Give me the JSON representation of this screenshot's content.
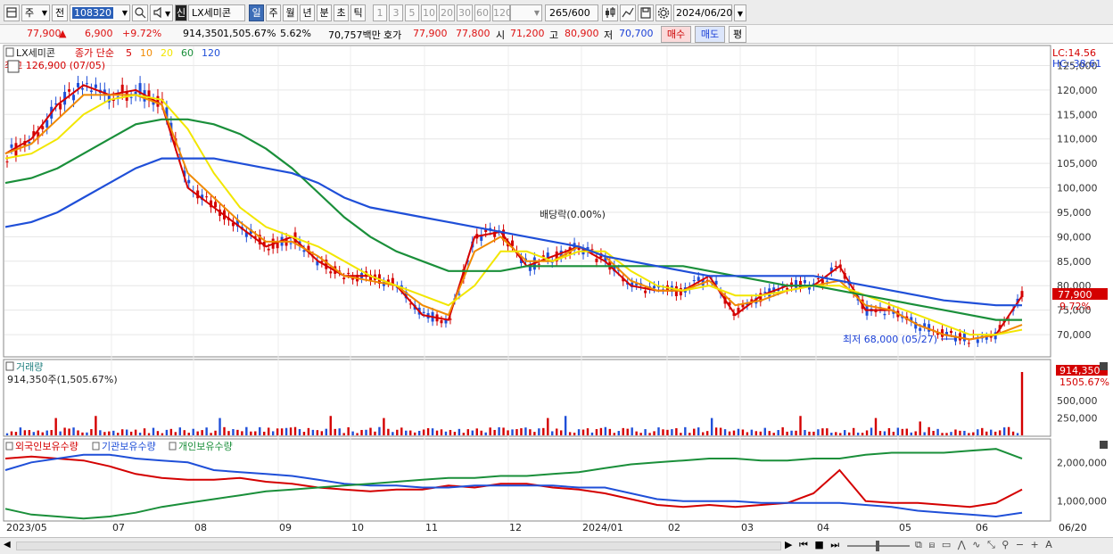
{
  "toolbar": {
    "market": "주",
    "prev_label": "전",
    "code": "108320",
    "name_prefix": "신",
    "name": "LX세미콘",
    "periods": [
      "일",
      "주",
      "월",
      "년",
      "분",
      "초",
      "틱"
    ],
    "active_period": "일",
    "intervals": [
      "1",
      "3",
      "5",
      "10",
      "20",
      "30",
      "60",
      "120"
    ],
    "count": "265",
    "count_max": "/600",
    "date": "2024/06/20"
  },
  "quote": {
    "price": "77,900",
    "change_arrow": "▲",
    "change": "6,900",
    "change_pct": "+9.72%",
    "volume": "914,350",
    "volume_pct": "1,505.67%",
    "turnover_pct": "5.62%",
    "amount": "70,757백만",
    "ask_label": "호가",
    "ask": "77,900",
    "bid": "77,800",
    "open_label": "시",
    "open": "71,200",
    "high_label": "고",
    "high": "80,900",
    "low_label": "저",
    "low": "70,700",
    "buy": "매수",
    "sell": "매도",
    "eval": "평"
  },
  "price_panel": {
    "name": "LX세미콘",
    "ma_label": "종가 단순",
    "ma_periods": [
      "5",
      "10",
      "20",
      "60",
      "120"
    ],
    "ma_colors": [
      "#d40000",
      "#f08a00",
      "#f2e600",
      "#1a8f3a",
      "#1f4fd8"
    ],
    "max_label": "최고 126,900 (07/05)",
    "min_label": "최저 68,000 (05/27)",
    "dividend_label": "배당락(0.00%)",
    "lc": "LC:14.56",
    "hc": "HC:-38.61",
    "last_price": "77,900",
    "last_pct": "9.72%",
    "y_ticks": [
      "125,000",
      "120,000",
      "115,000",
      "110,000",
      "105,000",
      "100,000",
      "95,000",
      "90,000",
      "85,000",
      "80,000",
      "75,000",
      "70,000"
    ]
  },
  "volume_panel": {
    "title": "거래량",
    "value": "914,350주(1,505.67%)",
    "last": "914,350",
    "last_pct": "1505.67%",
    "y_ticks": [
      "500,000",
      "250,000"
    ]
  },
  "holdings_panel": {
    "series": [
      "외국인보유수량",
      "기관보유수량",
      "개인보유수량"
    ],
    "colors": [
      "#d40000",
      "#1f4fd8",
      "#1a8f3a"
    ],
    "y_ticks": [
      "2,000,000",
      "1,000,000"
    ]
  },
  "x_axis": [
    "2023/05",
    "07",
    "08",
    "09",
    "10",
    "11",
    "12",
    "2024/01",
    "02",
    "03",
    "04",
    "05",
    "06",
    "06/20"
  ],
  "chart_data": {
    "type": "candlestick",
    "price_series": [
      {
        "name": "5",
        "values": [
          107000,
          110000,
          117000,
          121000,
          119000,
          120000,
          117000,
          100000,
          96000,
          92000,
          88000,
          90000,
          85000,
          82000,
          82000,
          80000,
          74000,
          73000,
          90000,
          91000,
          84000,
          86000,
          88000,
          85000,
          80000,
          79000,
          79000,
          82000,
          74000,
          78000,
          80000,
          80000,
          84000,
          75000,
          75000,
          72000,
          70000,
          69000,
          70000,
          77900
        ]
      },
      {
        "name": "10",
        "values": [
          107000,
          109000,
          114000,
          119000,
          119000,
          119000,
          117000,
          103000,
          98000,
          93000,
          89000,
          89000,
          86000,
          82000,
          81000,
          80000,
          76000,
          74000,
          87000,
          90000,
          85000,
          85000,
          88000,
          86000,
          81000,
          79000,
          79000,
          81000,
          76000,
          77000,
          79000,
          80000,
          81000,
          76000,
          75000,
          72000,
          70000,
          69000,
          70000,
          72000
        ]
      },
      {
        "name": "20",
        "values": [
          106000,
          107000,
          110000,
          115000,
          118000,
          119000,
          118000,
          112000,
          103000,
          96000,
          92000,
          90000,
          88000,
          85000,
          82000,
          80000,
          78000,
          76000,
          80000,
          87000,
          87000,
          85000,
          87000,
          87000,
          83000,
          80000,
          79000,
          80000,
          78000,
          78000,
          79000,
          80000,
          80000,
          78000,
          76000,
          74000,
          72000,
          70000,
          70000,
          71000
        ]
      },
      {
        "name": "60",
        "values": [
          101000,
          102000,
          104000,
          107000,
          110000,
          113000,
          114000,
          114000,
          113000,
          111000,
          108000,
          104000,
          99000,
          94000,
          90000,
          87000,
          85000,
          83000,
          83000,
          83000,
          84000,
          84000,
          84000,
          84000,
          84000,
          84000,
          84000,
          83000,
          82000,
          81000,
          80000,
          80000,
          79000,
          78000,
          77000,
          76000,
          75000,
          74000,
          73000,
          73000
        ]
      },
      {
        "name": "120",
        "values": [
          92000,
          93000,
          95000,
          98000,
          101000,
          104000,
          106000,
          106000,
          106000,
          105000,
          104000,
          103000,
          101000,
          98000,
          96000,
          95000,
          94000,
          93000,
          92000,
          91000,
          90000,
          89000,
          88000,
          86000,
          85000,
          84000,
          83000,
          82000,
          82000,
          82000,
          82000,
          82000,
          81000,
          80000,
          79000,
          78000,
          77000,
          76500,
          76000,
          76000
        ]
      }
    ],
    "holdings": [
      {
        "name": "외국인보유수량",
        "values": [
          2100000,
          2150000,
          2100000,
          2050000,
          1900000,
          1700000,
          1600000,
          1550000,
          1550000,
          1600000,
          1500000,
          1450000,
          1350000,
          1300000,
          1250000,
          1300000,
          1300000,
          1400000,
          1350000,
          1450000,
          1450000,
          1350000,
          1300000,
          1200000,
          1050000,
          900000,
          850000,
          900000,
          850000,
          900000,
          950000,
          1200000,
          1800000,
          1000000,
          950000,
          950000,
          900000,
          850000,
          950000,
          1300000
        ]
      },
      {
        "name": "기관보유수량",
        "values": [
          1800000,
          2000000,
          2100000,
          2200000,
          2200000,
          2100000,
          2050000,
          2000000,
          1800000,
          1750000,
          1700000,
          1650000,
          1550000,
          1450000,
          1400000,
          1400000,
          1350000,
          1350000,
          1400000,
          1400000,
          1400000,
          1400000,
          1350000,
          1350000,
          1200000,
          1050000,
          1000000,
          1000000,
          1000000,
          950000,
          950000,
          950000,
          950000,
          900000,
          850000,
          750000,
          700000,
          650000,
          600000,
          700000
        ]
      },
      {
        "name": "개인보유수량",
        "values": [
          800000,
          650000,
          600000,
          550000,
          600000,
          700000,
          850000,
          950000,
          1050000,
          1150000,
          1250000,
          1300000,
          1350000,
          1400000,
          1450000,
          1500000,
          1550000,
          1600000,
          1600000,
          1650000,
          1650000,
          1700000,
          1750000,
          1850000,
          1950000,
          2000000,
          2050000,
          2100000,
          2100000,
          2050000,
          2050000,
          2100000,
          2100000,
          2200000,
          2250000,
          2250000,
          2250000,
          2300000,
          2350000,
          2100000
        ]
      }
    ],
    "volume_peak": 914350,
    "ylim_price": [
      66000,
      128000
    ]
  }
}
